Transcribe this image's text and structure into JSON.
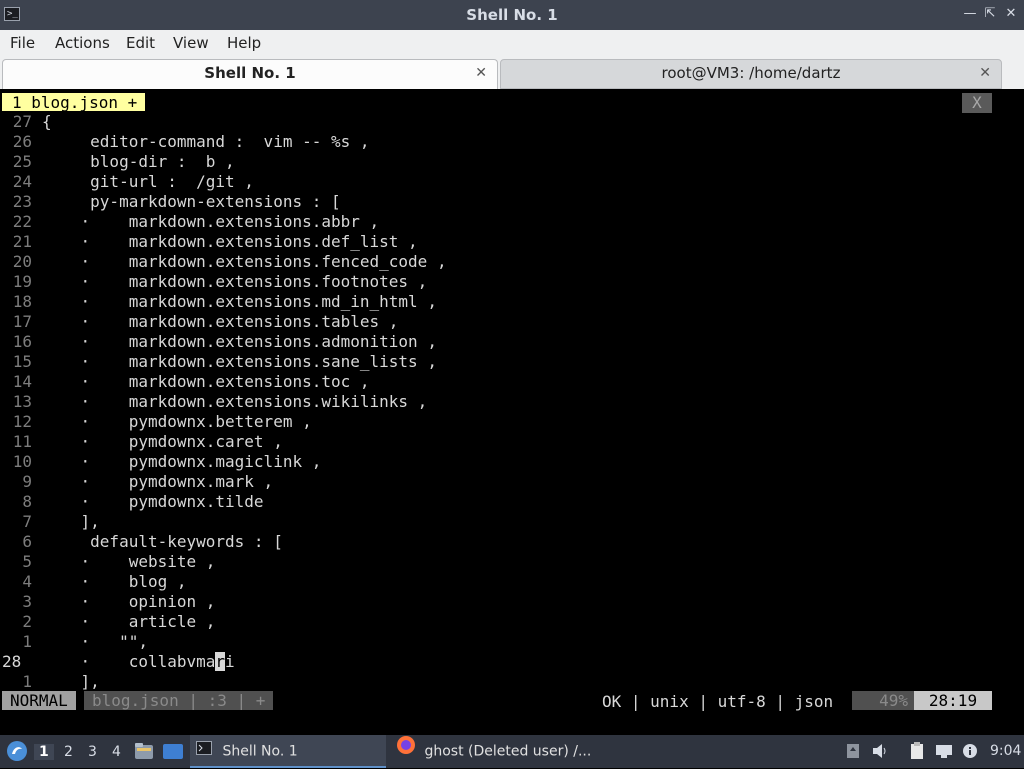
{
  "window": {
    "title": "Shell No. 1",
    "controls": [
      "minimize-icon",
      "maximize-icon",
      "close-icon"
    ]
  },
  "menubar": {
    "items": [
      "File",
      "Actions",
      "Edit",
      "View",
      "Help"
    ]
  },
  "tabs": [
    {
      "label": "Shell No. 1",
      "active": true
    },
    {
      "label": "root@VM3: /home/dartz",
      "active": false
    }
  ],
  "editor": {
    "buffer_tab": "1 blog.json +",
    "buffer_close": "X",
    "lines": [
      {
        "num": "27",
        "code": "{"
      },
      {
        "num": "26",
        "code": "     editor-command :  vim -- %s ,"
      },
      {
        "num": "25",
        "code": "     blog-dir :  b ,"
      },
      {
        "num": "24",
        "code": "     git-url :  /git ,"
      },
      {
        "num": "23",
        "code": "     py-markdown-extensions : ["
      },
      {
        "num": "22",
        "code": "    ·    markdown.extensions.abbr ,"
      },
      {
        "num": "21",
        "code": "    ·    markdown.extensions.def_list ,"
      },
      {
        "num": "20",
        "code": "    ·    markdown.extensions.fenced_code ,"
      },
      {
        "num": "19",
        "code": "    ·    markdown.extensions.footnotes ,"
      },
      {
        "num": "18",
        "code": "    ·    markdown.extensions.md_in_html ,"
      },
      {
        "num": "17",
        "code": "    ·    markdown.extensions.tables ,"
      },
      {
        "num": "16",
        "code": "    ·    markdown.extensions.admonition ,"
      },
      {
        "num": "15",
        "code": "    ·    markdown.extensions.sane_lists ,"
      },
      {
        "num": "14",
        "code": "    ·    markdown.extensions.toc ,"
      },
      {
        "num": "13",
        "code": "    ·    markdown.extensions.wikilinks ,"
      },
      {
        "num": "12",
        "code": "    ·    pymdownx.betterem ,"
      },
      {
        "num": "11",
        "code": "    ·    pymdownx.caret ,"
      },
      {
        "num": "10",
        "code": "    ·    pymdownx.magiclink ,"
      },
      {
        "num": "9",
        "code": "    ·    pymdownx.mark ,"
      },
      {
        "num": "8",
        "code": "    ·    pymdownx.tilde"
      },
      {
        "num": "7",
        "code": "    ],"
      },
      {
        "num": "6",
        "code": "     default-keywords : ["
      },
      {
        "num": "5",
        "code": "    ·    website ,"
      },
      {
        "num": "4",
        "code": "    ·    blog ,"
      },
      {
        "num": "3",
        "code": "    ·    opinion ,"
      },
      {
        "num": "2",
        "code": "    ·    article ,"
      },
      {
        "num": "1",
        "code": "    ·   \"\","
      },
      {
        "num": "28",
        "code": "    ·    collabvma",
        "cursor_char": "r",
        "after_cursor": "i",
        "current": true
      },
      {
        "num": "1",
        "code": "    ],"
      }
    ],
    "status": {
      "mode": "NORMAL",
      "file": "blog.json | :3 | +",
      "right": "OK | unix | utf-8 | json",
      "percent": "49%",
      "position": "28:19"
    }
  },
  "taskbar": {
    "workspaces": [
      "1",
      "2",
      "3",
      "4"
    ],
    "active_workspace": "1",
    "tasks": [
      {
        "label": "Shell No. 1",
        "icon": "terminal-icon",
        "active": true
      },
      {
        "label": "ghost (Deleted user) /...",
        "icon": "firefox-icon",
        "active": false
      }
    ],
    "clock": "9:04"
  }
}
